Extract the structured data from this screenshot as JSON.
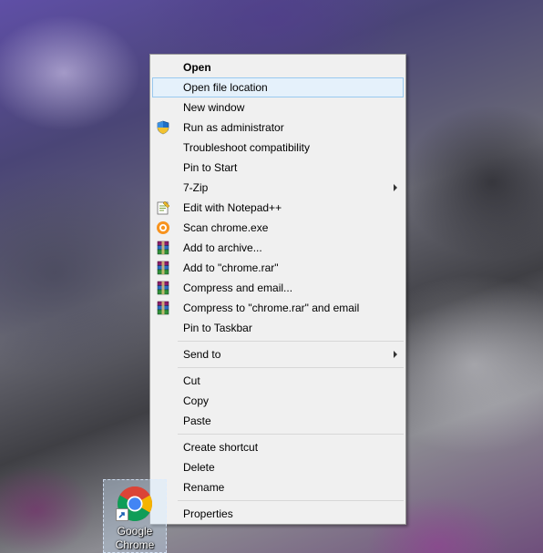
{
  "context_menu": {
    "items": [
      {
        "label": "Open",
        "bold": true
      },
      {
        "label": "Open file location",
        "highlighted": true
      },
      {
        "label": "New window"
      },
      {
        "label": "Run as administrator",
        "icon": "shield-icon"
      },
      {
        "label": "Troubleshoot compatibility"
      },
      {
        "label": "Pin to Start"
      },
      {
        "label": "7-Zip",
        "submenu": true
      },
      {
        "label": "Edit with Notepad++",
        "icon": "notepad-plus-plus-icon"
      },
      {
        "label": "Scan chrome.exe",
        "icon": "avast-icon"
      },
      {
        "label": "Add to archive...",
        "icon": "winrar-icon"
      },
      {
        "label": "Add to \"chrome.rar\"",
        "icon": "winrar-icon"
      },
      {
        "label": "Compress and email...",
        "icon": "winrar-icon"
      },
      {
        "label": "Compress to \"chrome.rar\" and email",
        "icon": "winrar-icon"
      },
      {
        "label": "Pin to Taskbar"
      },
      {
        "label": "Send to",
        "submenu": true
      },
      {
        "label": "Cut"
      },
      {
        "label": "Copy"
      },
      {
        "label": "Paste"
      },
      {
        "label": "Create shortcut"
      },
      {
        "label": "Delete"
      },
      {
        "label": "Rename"
      },
      {
        "label": "Properties"
      }
    ]
  },
  "desktop_icon": {
    "label_line1": "Google",
    "label_line2": "Chrome",
    "icon": "chrome-icon"
  },
  "colors": {
    "menu_background": "#f0f0f0",
    "highlight_background": "#e5f1fb",
    "highlight_border": "#99c9ef"
  }
}
